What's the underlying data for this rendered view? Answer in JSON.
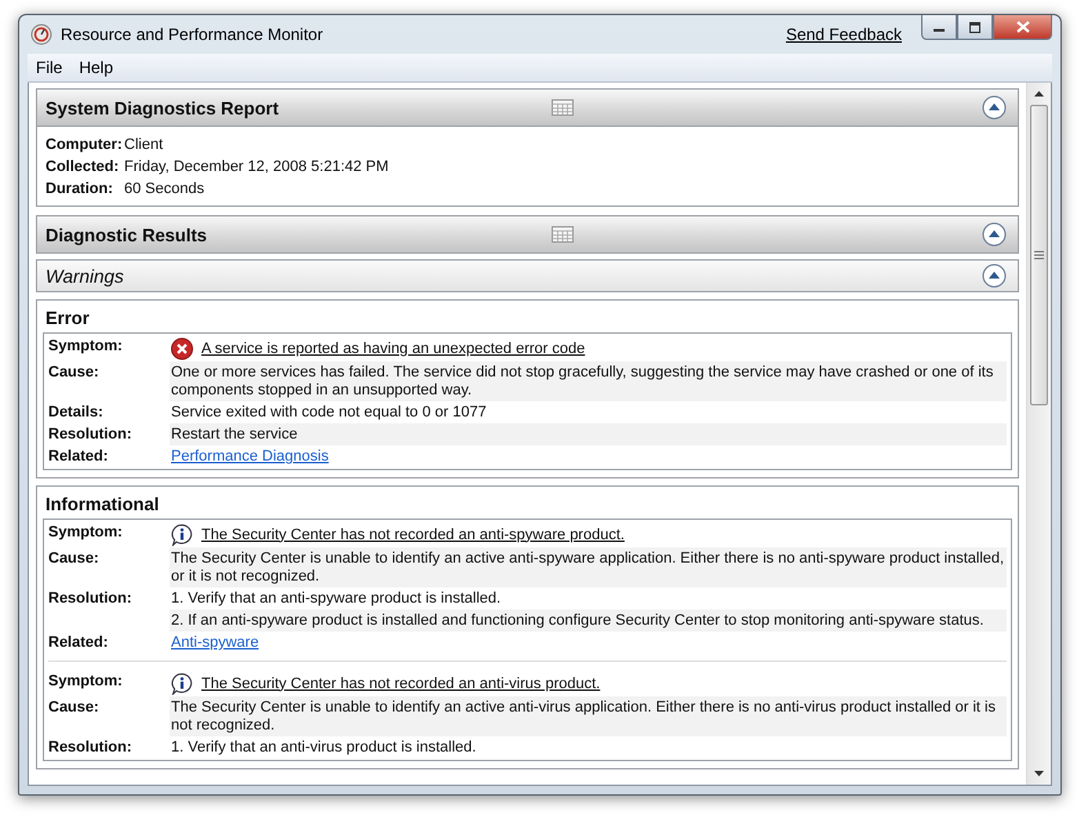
{
  "window": {
    "title": "Resource and Performance Monitor",
    "send_feedback": "Send Feedback"
  },
  "menu": [
    "File",
    "Help"
  ],
  "report": {
    "title": "System Diagnostics Report",
    "expanded": true,
    "fields": [
      {
        "label": "Computer:",
        "value": "Client"
      },
      {
        "label": "Collected:",
        "value": "Friday, December 12, 2008 5:21:42 PM"
      },
      {
        "label": "Duration:",
        "value": "60 Seconds"
      }
    ]
  },
  "results": {
    "title": "Diagnostic Results",
    "expanded": true
  },
  "warnings": {
    "title": "Warnings",
    "expanded": true
  },
  "groups": [
    {
      "title": "Error",
      "items": [
        {
          "kind": "error",
          "rows": [
            {
              "label": "Symptom:",
              "kind": "symptom",
              "text": "A service is reported as having an unexpected error code"
            },
            {
              "label": "Cause:",
              "kind": "text",
              "text": "One or more services has failed. The service did not stop gracefully, suggesting the service may have crashed or one of its components stopped in an unsupported way."
            },
            {
              "label": "Details:",
              "kind": "text",
              "text": "Service exited with code not equal to 0 or 1077"
            },
            {
              "label": "Resolution:",
              "kind": "text",
              "text": "Restart the service"
            },
            {
              "label": "Related:",
              "kind": "link",
              "text": "Performance Diagnosis"
            }
          ]
        }
      ]
    },
    {
      "title": "Informational",
      "items": [
        {
          "kind": "info",
          "rows": [
            {
              "label": "Symptom:",
              "kind": "symptom",
              "text": "The Security Center has not recorded an anti-spyware product."
            },
            {
              "label": "Cause:",
              "kind": "text",
              "text": "The Security Center is unable to identify an active anti-spyware application. Either there is no anti-spyware product installed, or it is not recognized."
            },
            {
              "label": "Resolution:",
              "kind": "text",
              "text": "1. Verify that an anti-spyware product is installed."
            },
            {
              "kind": "text",
              "text": "2. If an anti-spyware product is installed and functioning configure Security Center to stop monitoring anti-spyware status."
            },
            {
              "label": "Related:",
              "kind": "link",
              "text": "Anti-spyware"
            }
          ]
        },
        {
          "kind": "info",
          "rows": [
            {
              "label": "Symptom:",
              "kind": "symptom",
              "text": "The Security Center has not recorded an anti-virus product."
            },
            {
              "label": "Cause:",
              "kind": "text",
              "text": "The Security Center is unable to identify an active anti-virus application. Either there is no anti-virus product installed or it is not recognized."
            },
            {
              "label": "Resolution:",
              "kind": "text",
              "text": "1. Verify that an anti-virus product is installed."
            }
          ]
        }
      ]
    }
  ]
}
